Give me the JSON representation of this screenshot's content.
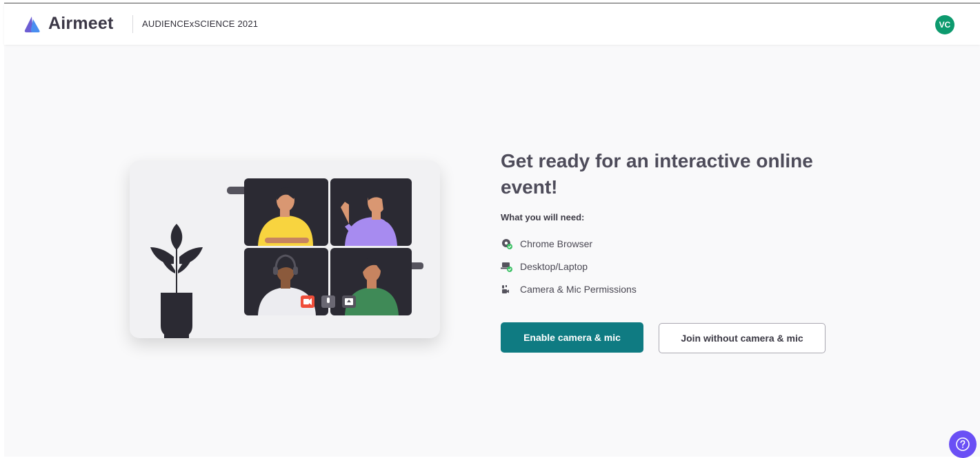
{
  "header": {
    "brand": "Airmeet",
    "event_name": "AUDIENCExSCIENCE 2021",
    "avatar_initials": "VC"
  },
  "main": {
    "headline": "Get ready for an interactive online event!",
    "needs_label": "What you will need:",
    "requirements": [
      {
        "label": "Chrome Browser",
        "icon": "chrome-icon"
      },
      {
        "label": "Desktop/Laptop",
        "icon": "laptop-icon"
      },
      {
        "label": "Camera & Mic Permissions",
        "icon": "camera-mic-icon"
      }
    ],
    "primary_button": "Enable camera & mic",
    "secondary_button": "Join without camera & mic"
  },
  "colors": {
    "primary": "#0f7b82",
    "avatar": "#0d9a6e",
    "help": "#6a4ff5",
    "check": "#3ac063"
  },
  "help_icon": "question-circle-icon"
}
